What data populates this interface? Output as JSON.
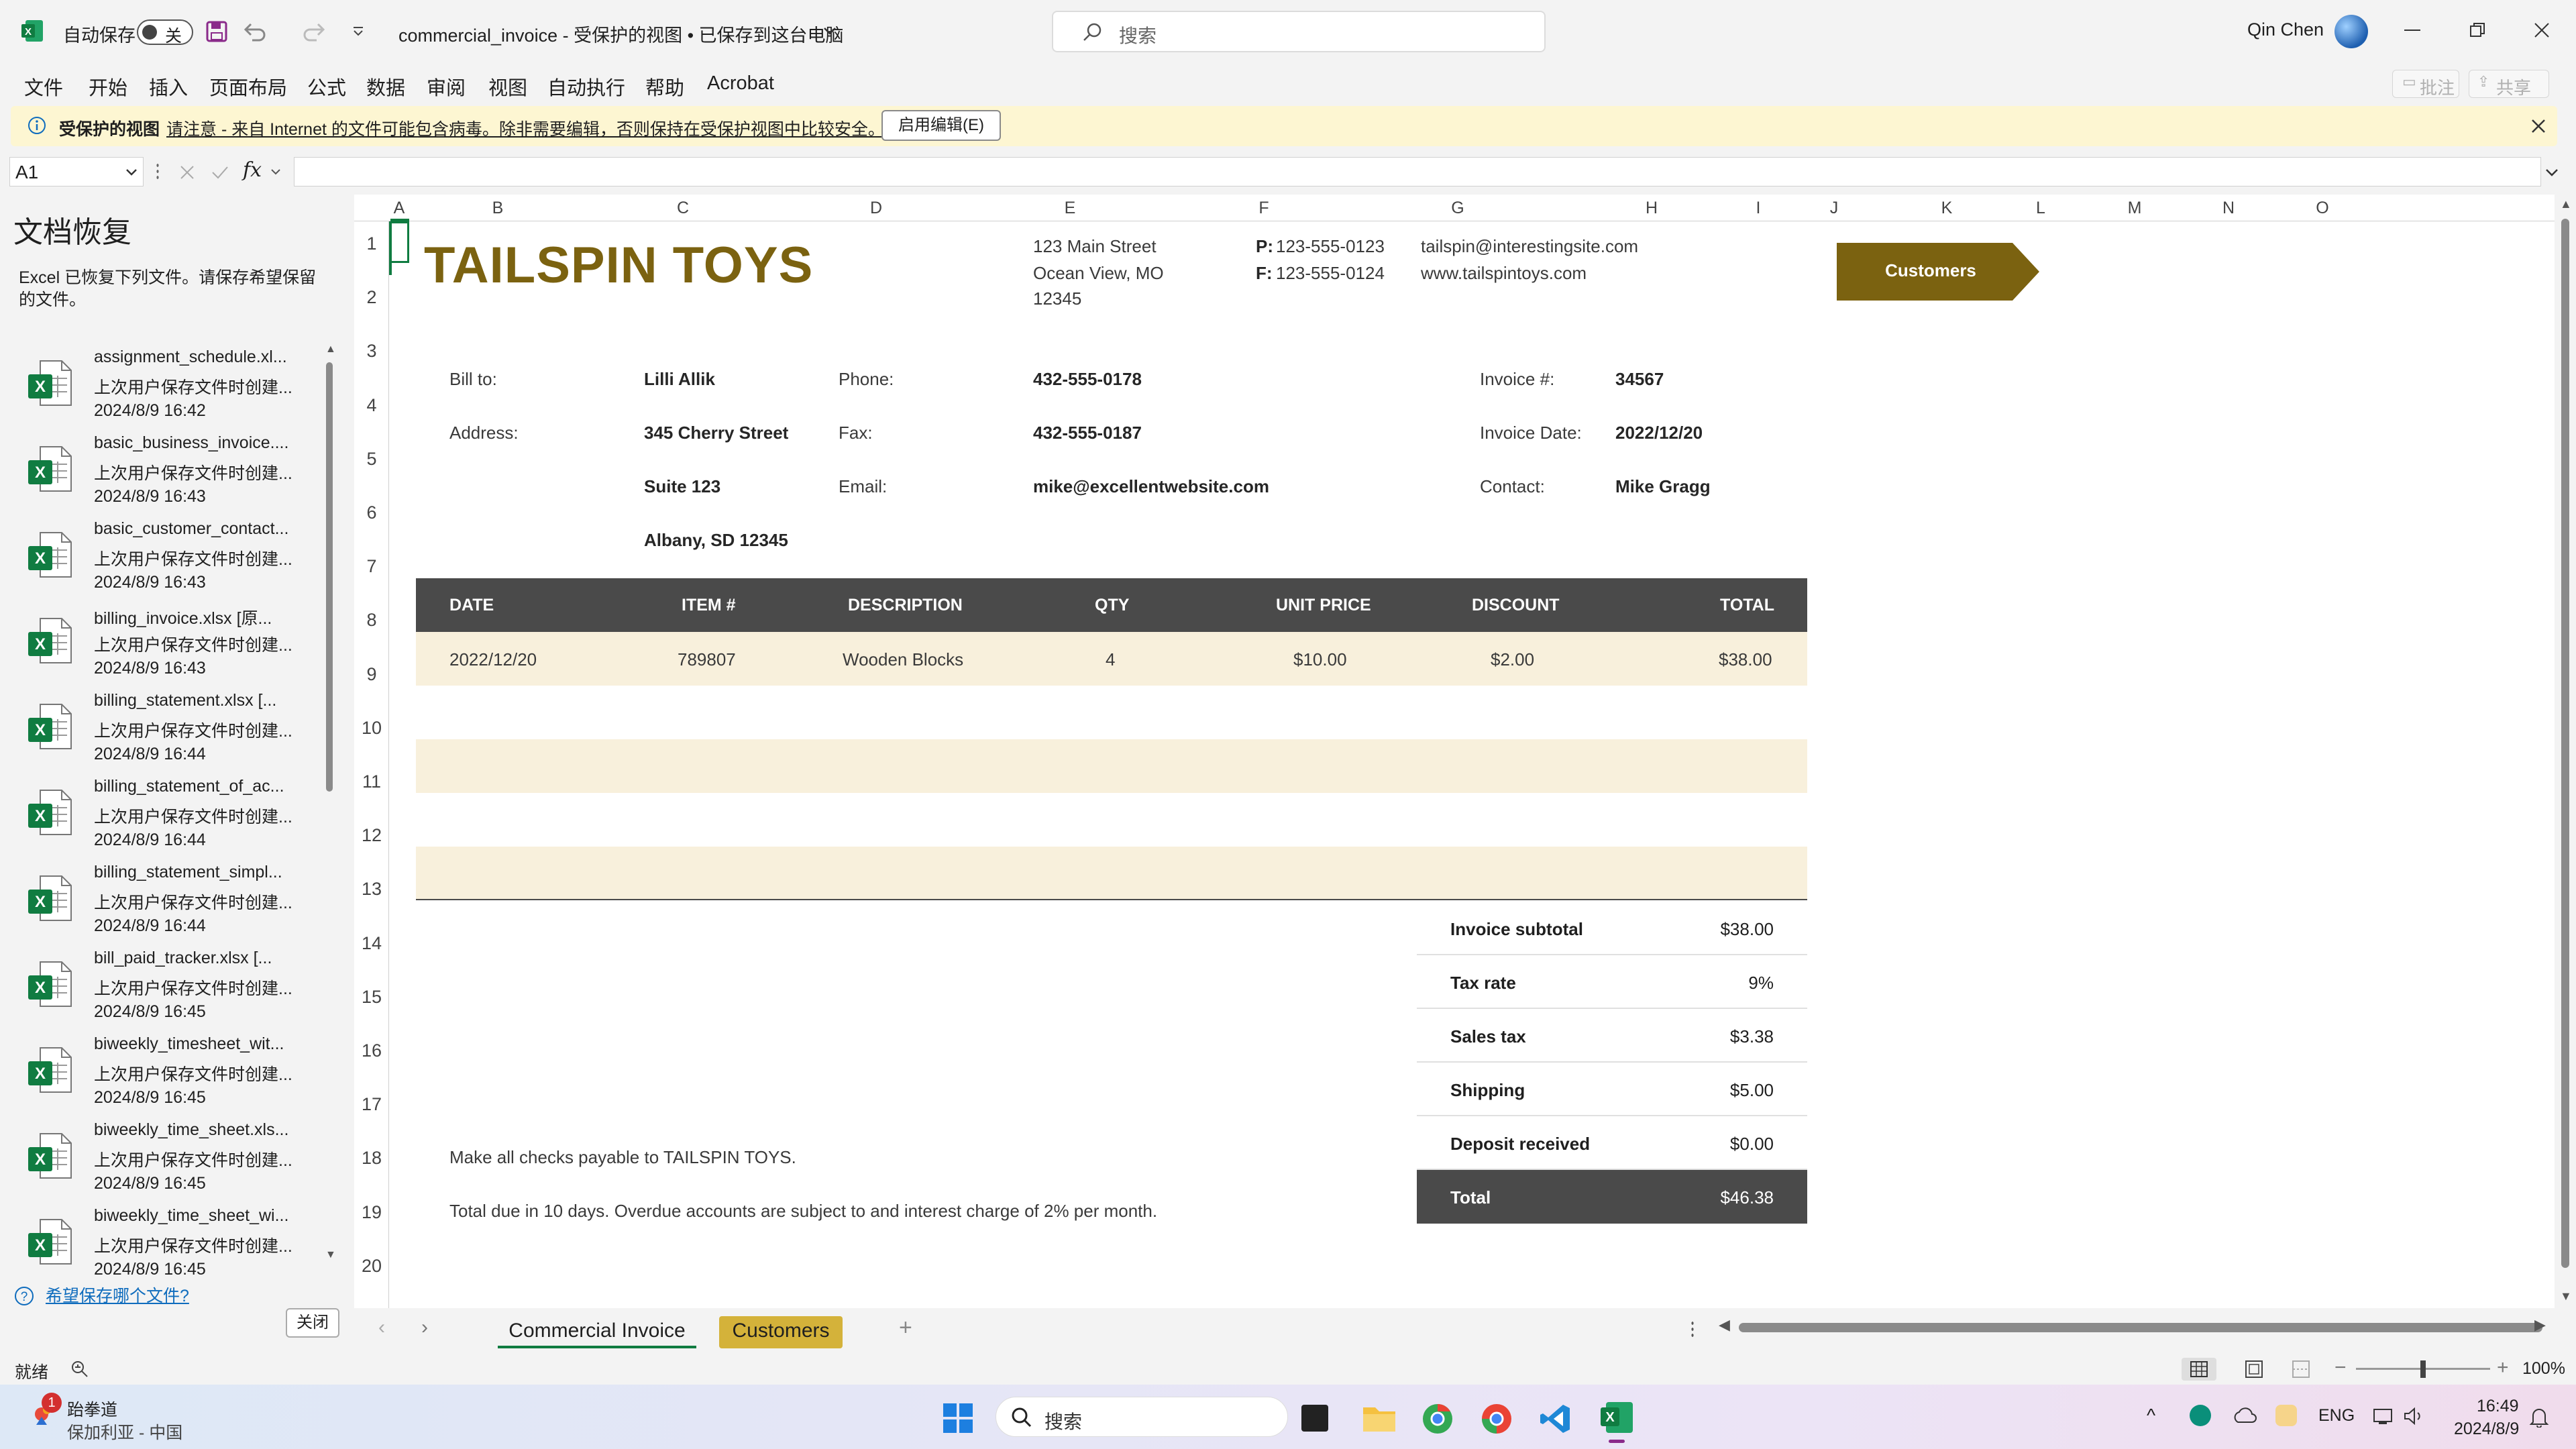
{
  "titlebar": {
    "autosave_label": "自动保存",
    "autosave_state": "关",
    "doc_title": "commercial_invoice  -  受保护的视图 • 已保存到这台电脑",
    "search_placeholder": "搜索",
    "user_name": "Qin Chen",
    "comment_label": "批注",
    "share_label": "共享"
  },
  "menu": [
    "文件",
    "开始",
    "插入",
    "页面布局",
    "公式",
    "数据",
    "审阅",
    "视图",
    "自动执行",
    "帮助",
    "Acrobat"
  ],
  "banner": {
    "title": "受保护的视图",
    "message": "请注意 - 来自 Internet 的文件可能包含病毒。除非需要编辑，否则保持在受保护视图中比较安全。",
    "enable_button": "启用编辑(E)"
  },
  "formula_bar": {
    "name_box": "A1",
    "fx": "fx",
    "value": ""
  },
  "recovery": {
    "title": "文档恢复",
    "description": "Excel 已恢复下列文件。请保存希望保留的文件。",
    "subtitle_common": "上次用户保存文件时创建...",
    "files": [
      {
        "name": "assignment_schedule.xl...",
        "date": "2024/8/9 16:42"
      },
      {
        "name": "basic_business_invoice....",
        "date": "2024/8/9 16:43"
      },
      {
        "name": "basic_customer_contact...",
        "date": "2024/8/9 16:43"
      },
      {
        "name": "billing_invoice.xlsx  [原...",
        "date": "2024/8/9 16:43"
      },
      {
        "name": "billing_statement.xlsx  [...",
        "date": "2024/8/9 16:44"
      },
      {
        "name": "billing_statement_of_ac...",
        "date": "2024/8/9 16:44"
      },
      {
        "name": "billing_statement_simpl...",
        "date": "2024/8/9 16:44"
      },
      {
        "name": "bill_paid_tracker.xlsx  [...",
        "date": "2024/8/9 16:45"
      },
      {
        "name": "biweekly_timesheet_wit...",
        "date": "2024/8/9 16:45"
      },
      {
        "name": "biweekly_time_sheet.xls...",
        "date": "2024/8/9 16:45"
      },
      {
        "name": "biweekly_time_sheet_wi...",
        "date": "2024/8/9 16:45"
      }
    ],
    "link": "希望保存哪个文件?",
    "close_button": "关闭"
  },
  "grid": {
    "columns": [
      "A",
      "B",
      "C",
      "D",
      "E",
      "F",
      "G",
      "H",
      "I",
      "J",
      "K",
      "L",
      "M",
      "N",
      "O"
    ],
    "rows": [
      "1",
      "2",
      "3",
      "4",
      "5",
      "6",
      "7",
      "8",
      "9",
      "10",
      "11",
      "12",
      "13",
      "14",
      "15",
      "16",
      "17",
      "18",
      "19",
      "20"
    ]
  },
  "invoice": {
    "company": "TAILSPIN TOYS",
    "address1": "123 Main Street",
    "address2": "Ocean View,  MO",
    "address3": "12345",
    "phone_label": "P:",
    "phone": "123-555-0123",
    "fax_label": "F:",
    "fax": "123-555-0124",
    "email": "tailspin@interestingsite.com",
    "website": "www.tailspintoys.com",
    "customers_button": "Customers",
    "bill_to_label": "Bill to:",
    "bill_to": "Lilli Allik",
    "address_label": "Address:",
    "street": "345 Cherry Street",
    "suite": "Suite 123",
    "city": "Albany, SD 12345",
    "phone_label2": "Phone:",
    "cust_phone": "432-555-0178",
    "fax_label2": "Fax:",
    "cust_fax": "432-555-0187",
    "email_label": "Email:",
    "cust_email": "mike@excellentwebsite.com",
    "invoice_no_label": "Invoice #:",
    "invoice_no": "34567",
    "invoice_date_label": "Invoice Date:",
    "invoice_date": "2022/12/20",
    "contact_label": "Contact:",
    "contact": "Mike Gragg",
    "table_headers": [
      "DATE",
      "ITEM #",
      "DESCRIPTION",
      "QTY",
      "UNIT PRICE",
      "DISCOUNT",
      "TOTAL"
    ],
    "row": [
      "2022/12/20",
      "789807",
      "Wooden Blocks",
      "4",
      "$10.00",
      "$2.00",
      "$38.00"
    ],
    "summary": [
      {
        "label": "Invoice subtotal",
        "value": "$38.00"
      },
      {
        "label": "Tax rate",
        "value": "9%"
      },
      {
        "label": "Sales tax",
        "value": "$3.38"
      },
      {
        "label": "Shipping",
        "value": "$5.00"
      },
      {
        "label": "Deposit received",
        "value": "$0.00"
      },
      {
        "label": "Total",
        "value": "$46.38"
      }
    ],
    "note1": "Make all checks payable to TAILSPIN TOYS.",
    "note2": "Total due in 10 days. Overdue accounts are subject to and interest charge of 2% per month."
  },
  "sheets": {
    "tab1": "Commercial Invoice",
    "tab2": "Customers"
  },
  "status": {
    "ready": "就绪",
    "zoom": "100%"
  },
  "taskbar": {
    "weather_title": "跆拳道",
    "weather_sub": "保加利亚 - 中国",
    "badge": "1",
    "search": "搜索",
    "lang": "ENG",
    "time": "16:49",
    "date": "2024/8/9"
  },
  "colors": {
    "accent": "#7b6210",
    "header": "#4a4a4a",
    "band": "#f8f0dc",
    "excel_green": "#107c41"
  }
}
